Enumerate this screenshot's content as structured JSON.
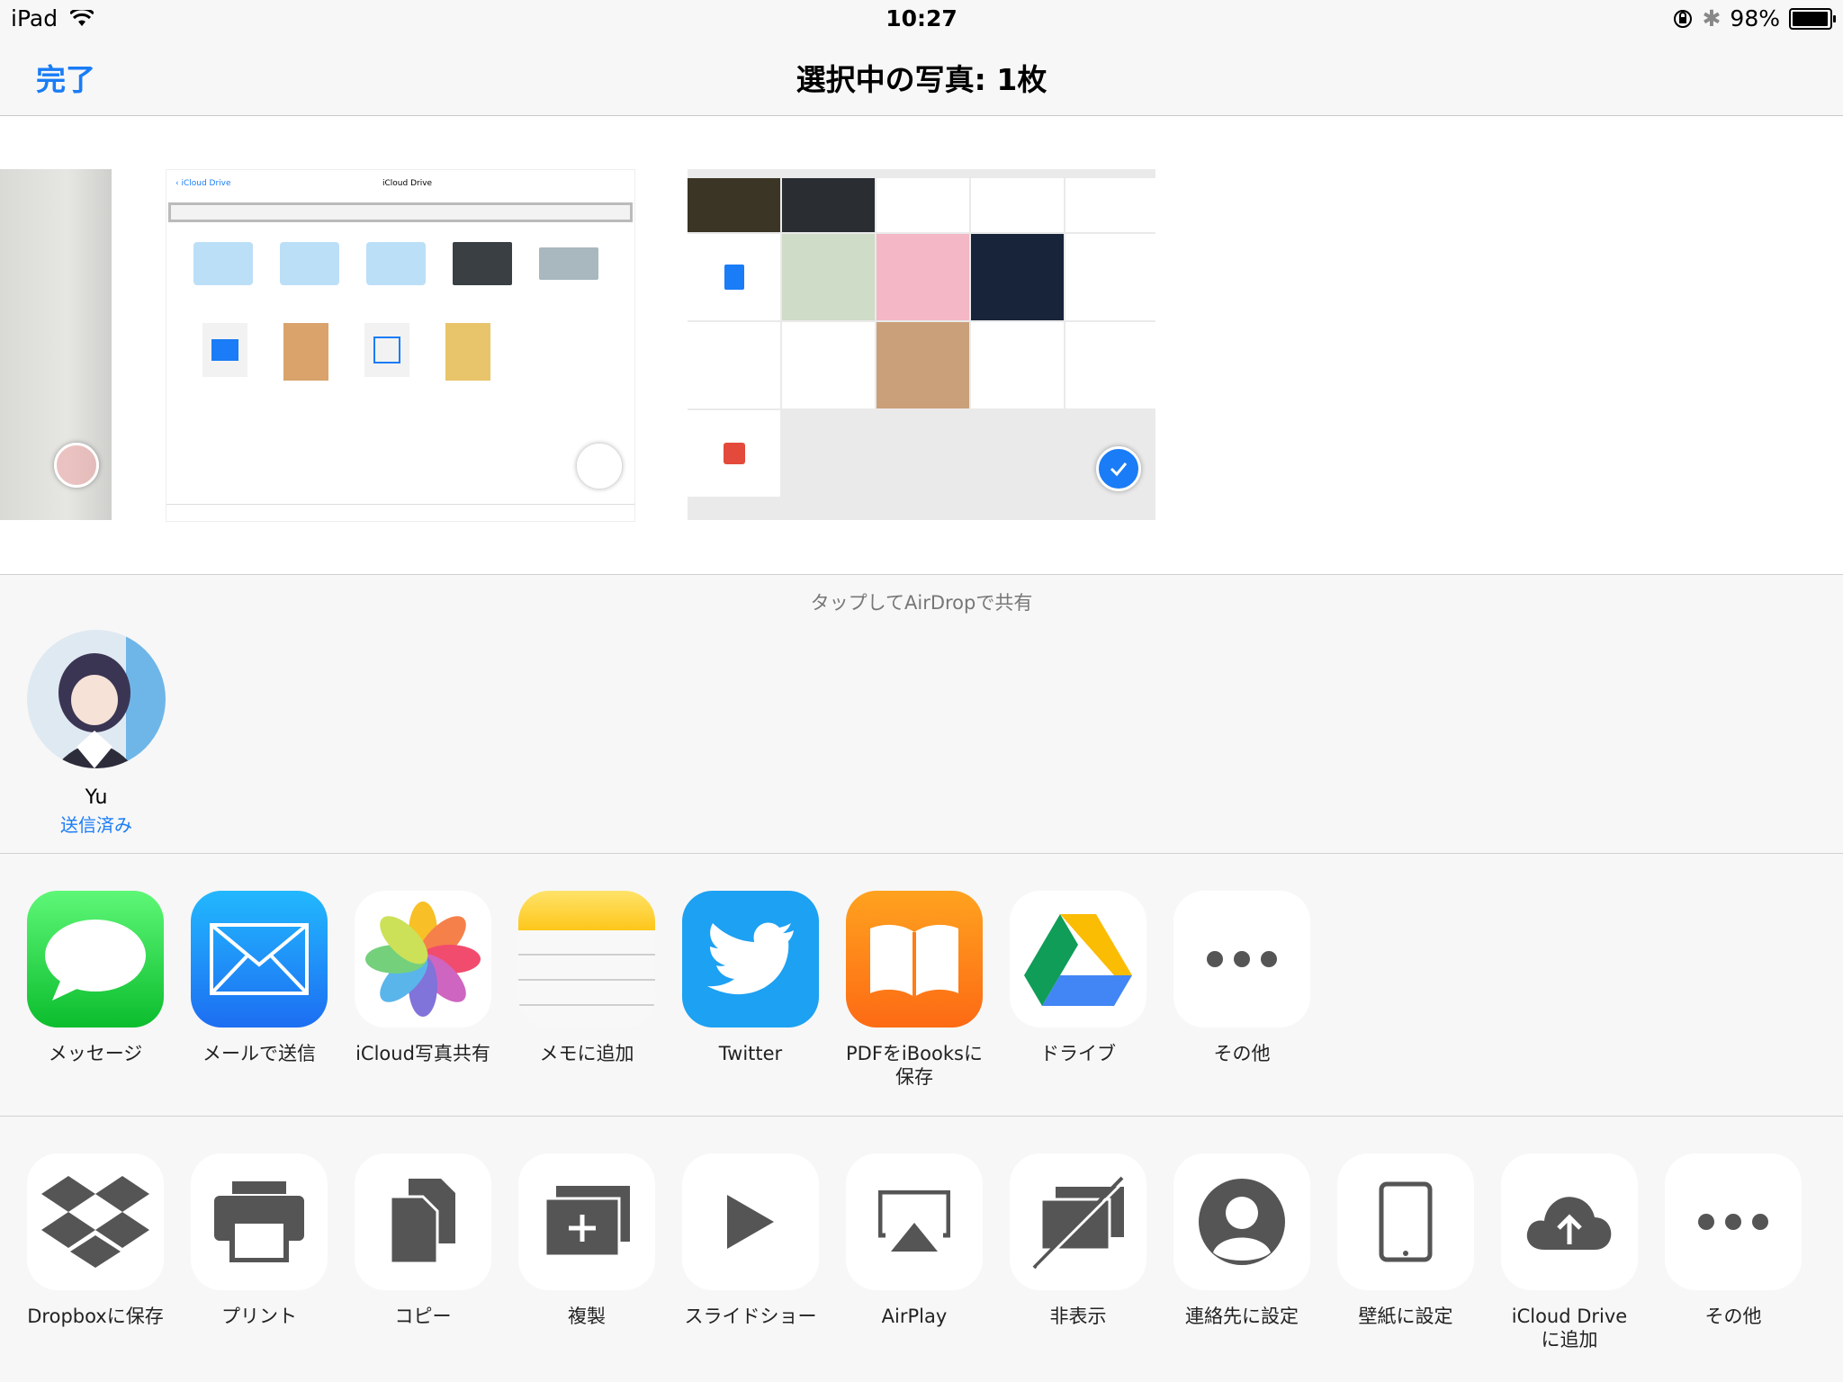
{
  "status_bar": {
    "device": "iPad",
    "time": "10:27",
    "battery": "98%",
    "battery_level": 0.98
  },
  "nav": {
    "done_label": "完了",
    "title": "選択中の写真: 1枚"
  },
  "photos": {
    "items": [
      {
        "selected": false
      },
      {
        "selected": false
      },
      {
        "selected": true
      }
    ],
    "icloud_thumb": {
      "back": "iCloud Drive",
      "title": "iCloud Drive"
    }
  },
  "airdrop": {
    "label": "タップしてAirDropで共有",
    "contacts": [
      {
        "name": "Yu",
        "status": "送信済み"
      }
    ]
  },
  "share_apps": [
    {
      "label": "メッセージ",
      "icon": "messages-icon"
    },
    {
      "label": "メールで送信",
      "icon": "mail-icon"
    },
    {
      "label": "iCloud写真共有",
      "icon": "photos-icon"
    },
    {
      "label": "メモに追加",
      "icon": "notes-icon"
    },
    {
      "label": "Twitter",
      "icon": "twitter-icon"
    },
    {
      "label": "PDFをiBooksに\n保存",
      "icon": "ibooks-icon"
    },
    {
      "label": "ドライブ",
      "icon": "drive-icon"
    },
    {
      "label": "その他",
      "icon": "more-icon"
    }
  ],
  "actions": [
    {
      "label": "Dropboxに保存",
      "icon": "dropbox-icon"
    },
    {
      "label": "プリント",
      "icon": "print-icon"
    },
    {
      "label": "コピー",
      "icon": "copy-icon"
    },
    {
      "label": "複製",
      "icon": "duplicate-icon"
    },
    {
      "label": "スライドショー",
      "icon": "slideshow-icon"
    },
    {
      "label": "AirPlay",
      "icon": "airplay-icon"
    },
    {
      "label": "非表示",
      "icon": "hide-icon"
    },
    {
      "label": "連絡先に設定",
      "icon": "contact-icon"
    },
    {
      "label": "壁紙に設定",
      "icon": "wallpaper-icon"
    },
    {
      "label": "iCloud Drive\nに追加",
      "icon": "icloud-upload-icon"
    },
    {
      "label": "その他",
      "icon": "more-icon"
    }
  ],
  "colors": {
    "accent": "#1a7cf6",
    "separator": "#d2d2d2"
  }
}
